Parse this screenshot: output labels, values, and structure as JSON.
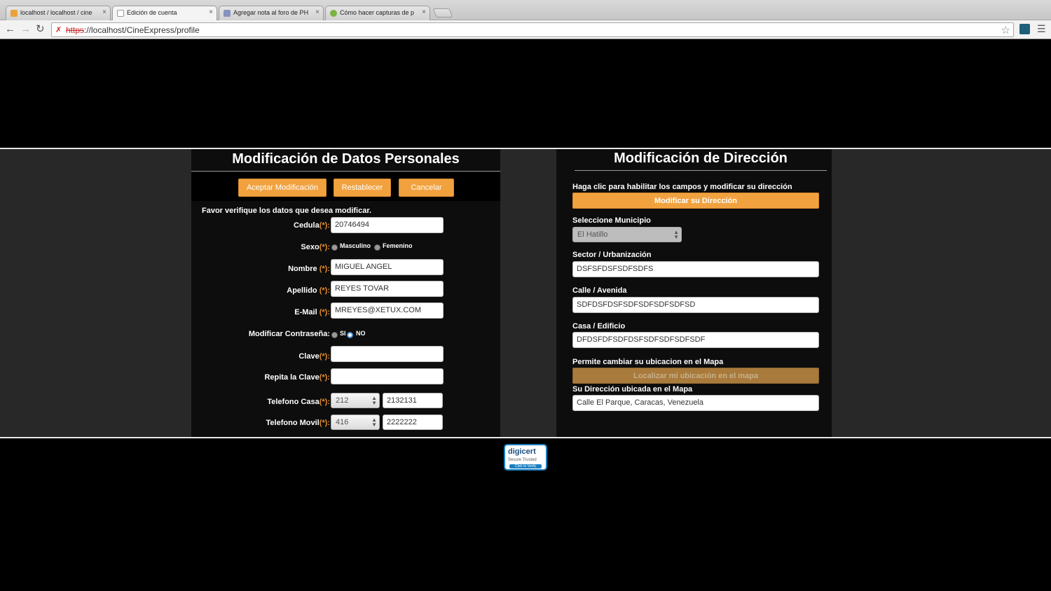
{
  "browser": {
    "tabs": [
      {
        "title": "localhost / localhost / cine",
        "close": "×"
      },
      {
        "title": "Edición de cuenta",
        "close": "×"
      },
      {
        "title": "Agregar nota al foro de PH",
        "close": "×"
      },
      {
        "title": "Cómo hacer capturas de p",
        "close": "×"
      }
    ],
    "url_scheme": "https",
    "url_rest": "://localhost/CineExpress/profile"
  },
  "personal": {
    "title": "Modificación de Datos Personales",
    "buttons": {
      "accept": "Aceptar Modificación",
      "reset": "Restablecer",
      "cancel": "Cancelar"
    },
    "notice": "Favor verifique los datos que desea modificar.",
    "cedula": {
      "label": "Cedula",
      "value": "20746494"
    },
    "sexo": {
      "label": "Sexo",
      "male": "Masculino",
      "female": "Femenino"
    },
    "nombre": {
      "label": "Nombre ",
      "value": "MIGUEL ANGEL"
    },
    "apellido": {
      "label": "Apellido ",
      "value": "REYES TOVAR"
    },
    "email": {
      "label": "E-Mail ",
      "value": "MREYES@XETUX.COM"
    },
    "pwd_change": {
      "label": "Modificar Contraseña:",
      "yes": "SI",
      "no": "NO"
    },
    "clave": {
      "label": "Clave"
    },
    "repita": {
      "label": "Repita la Clave"
    },
    "tel_casa": {
      "label": "Telefono Casa",
      "code": "212",
      "number": "2132131"
    },
    "tel_movil": {
      "label": "Telefono Movil",
      "code": "416",
      "number": "2222222"
    },
    "req_mark": "(*):"
  },
  "address": {
    "title": "Modificación de Dirección",
    "enable_hint": "Haga clic para habilitar los campos y modificar su dirección",
    "modify_button": "Modificar su Dirección",
    "municipio": {
      "label": "Seleccione Municipio",
      "value": "El Hatillo"
    },
    "sector": {
      "label": "Sector / Urbanización",
      "value": "DSFSFDSFSDFSDFS"
    },
    "calle": {
      "label": "Calle / Avenida",
      "value": "SDFDSFDSFSDFSDFSDFSDFSD"
    },
    "casa": {
      "label": "Casa / Edificio",
      "value": "DFDSFDFSDFDSFSDFSDFSDFSDF"
    },
    "map_hint": "Permite cambiar su ubicacion en el Mapa",
    "locate_button": "Localizar mi ubicación en el mapa",
    "map_address": {
      "label": "Su Dirección ubicada en el Mapa",
      "value": "Calle El Parque, Caracas, Venezuela"
    }
  },
  "seal": {
    "brand": "digicert",
    "sub": "Secure Trusted",
    "cta": "Click to Verify"
  },
  "colors": {
    "accent": "#f1a23f",
    "required": "#e08b2c",
    "panel": "#0d0d0d",
    "band": "#282828"
  }
}
